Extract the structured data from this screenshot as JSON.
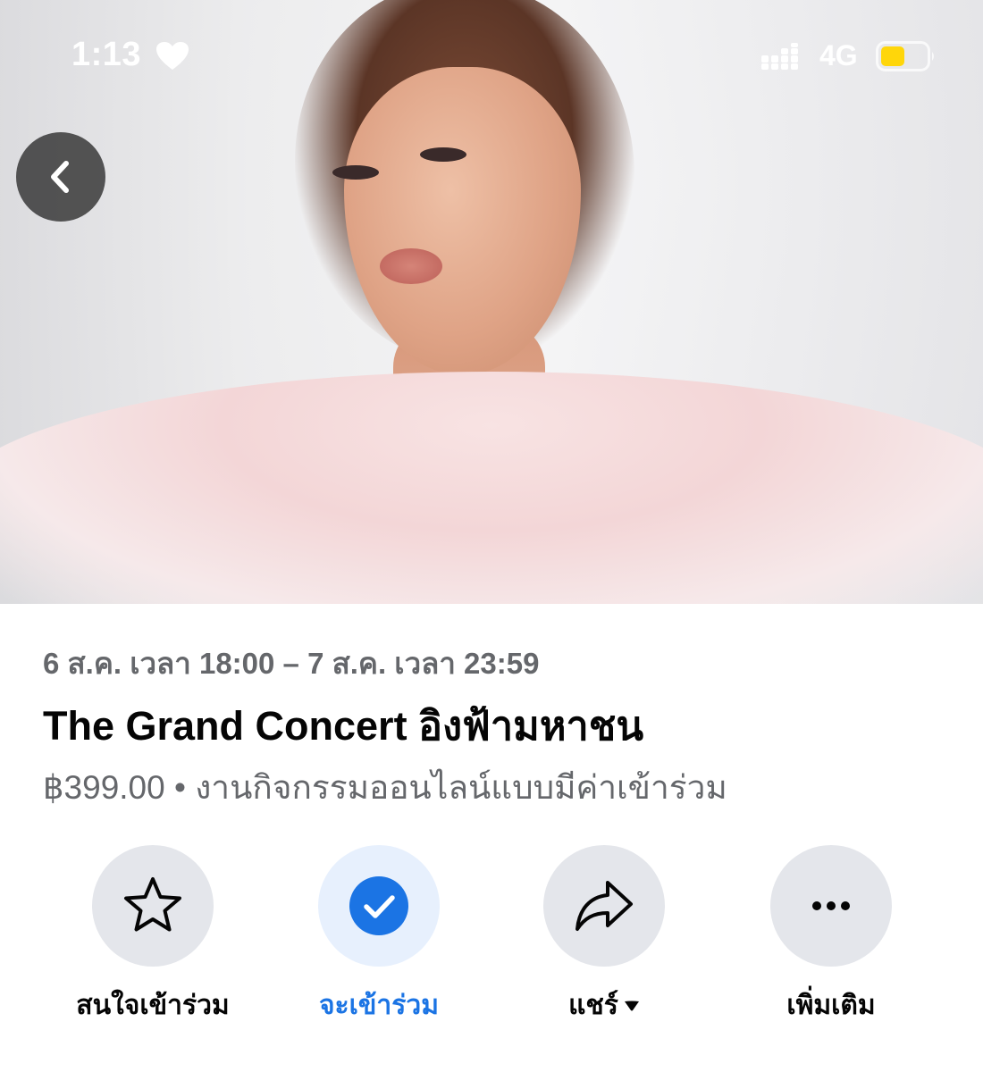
{
  "status_bar": {
    "time": "1:13",
    "network": "4G",
    "icons": [
      "heart-icon",
      "signal-icon",
      "battery-icon"
    ],
    "battery_color": "#ffd60a"
  },
  "header": {
    "back_icon": "chevron-left-icon"
  },
  "event": {
    "date_time": "6 ส.ค. เวลา 18:00 – 7 ส.ค. เวลา 23:59",
    "title": "The Grand Concert อิงฟ้ามหาชน",
    "price_line": "฿399.00 • งานกิจกรรมออนไลน์แบบมีค่าเข้าร่วม"
  },
  "actions": [
    {
      "label": "สนใจเข้าร่วม",
      "icon": "star-icon",
      "active": false
    },
    {
      "label": "จะเข้าร่วม",
      "icon": "check-circle-icon",
      "active": true
    },
    {
      "label": "แชร์",
      "icon": "share-arrow-icon",
      "active": false,
      "has_dropdown": true
    },
    {
      "label": "เพิ่มเติม",
      "icon": "more-dots-icon",
      "active": false
    }
  ],
  "colors": {
    "accent": "#1b74e4",
    "secondary_text": "#65676b",
    "primary_text": "#050505",
    "action_circle": "#e4e6eb",
    "active_circle": "#e7f0fd"
  }
}
